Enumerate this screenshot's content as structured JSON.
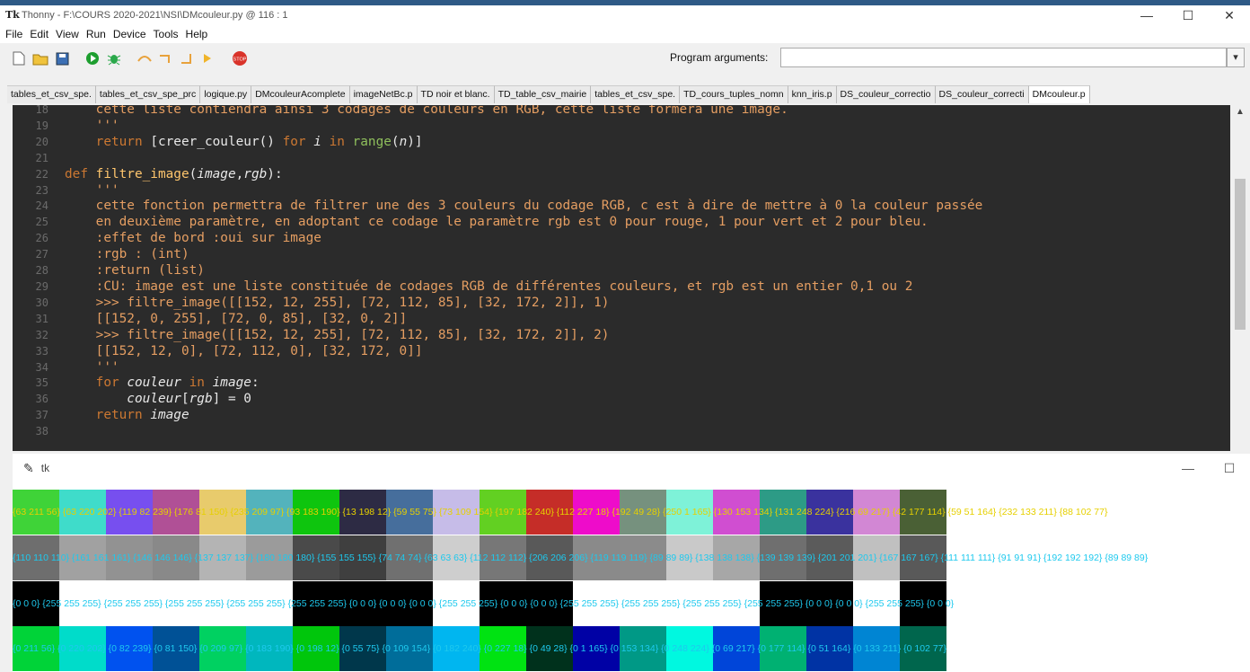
{
  "window": {
    "title": "Thonny  -  F:\\COURS 2020-2021\\NSI\\DMcouleur.py  @  116 : 1",
    "app_icon": "Tk"
  },
  "menu": [
    "File",
    "Edit",
    "View",
    "Run",
    "Device",
    "Tools",
    "Help"
  ],
  "toolbar": {
    "icons": [
      "new-file-icon",
      "open-file-icon",
      "save-icon",
      "run-icon",
      "debug-icon",
      "step-over-icon",
      "step-into-icon",
      "step-out-icon",
      "resume-icon",
      "stop-icon"
    ],
    "program_args_label": "Program arguments:",
    "program_args_value": ""
  },
  "tabs": [
    "tables_et_csv_spe.",
    "tables_et_csv_spe_prc",
    "logique.py",
    "DMcouleurAcomplete",
    "imageNetBc.p",
    "TD noir et blanc.",
    "TD_table_csv_mairie",
    "tables_et_csv_spe.",
    "TD_cours_tuples_nomn",
    "knn_iris.p",
    "DS_couleur_correctio",
    "DS_couleur_correcti",
    "DMcouleur.p"
  ],
  "editor": {
    "line_numbers": [
      "18",
      "19",
      "20",
      "21",
      "22",
      "23",
      "24",
      "25",
      "26",
      "27",
      "28",
      "29",
      "30",
      "31",
      "32",
      "33",
      "34",
      "35",
      "36",
      "37",
      "38"
    ],
    "lines": [
      [
        [
          "s",
          "    cette liste contiendra ainsi 3 codages de couleurs en RGB, cette liste formera une image."
        ]
      ],
      [
        [
          "s",
          "    '''"
        ]
      ],
      [
        [
          "kw",
          "    return "
        ],
        [
          "n",
          "[creer_couleur() "
        ],
        [
          "kw",
          "for "
        ],
        [
          "it",
          "i"
        ],
        [
          "kw",
          " in "
        ],
        [
          "bi",
          "range"
        ],
        [
          "n",
          "("
        ],
        [
          "it",
          "n"
        ],
        [
          "n",
          ")]"
        ]
      ],
      [
        [
          "n",
          ""
        ]
      ],
      [
        [
          "kw",
          "def "
        ],
        [
          "fn",
          "filtre_image"
        ],
        [
          "n",
          "("
        ],
        [
          "it",
          "image"
        ],
        [
          "n",
          ","
        ],
        [
          "it",
          "rgb"
        ],
        [
          "n",
          "):"
        ]
      ],
      [
        [
          "s",
          "    '''"
        ]
      ],
      [
        [
          "s",
          "    cette fonction permettra de filtrer une des 3 couleurs du codage RGB, c est à dire de mettre à 0 la couleur passée"
        ]
      ],
      [
        [
          "s",
          "    en deuxième paramètre, en adoptant ce codage le paramètre rgb est 0 pour rouge, 1 pour vert et 2 pour bleu."
        ]
      ],
      [
        [
          "s",
          "    :effet de bord :oui sur image"
        ]
      ],
      [
        [
          "s",
          "    :rgb : (int)"
        ]
      ],
      [
        [
          "s",
          "    :return (list)"
        ]
      ],
      [
        [
          "s",
          "    :CU: image est une liste constituée de codages RGB de différentes couleurs, et rgb est un entier 0,1 ou 2"
        ]
      ],
      [
        [
          "s",
          "    >>> filtre_image([[152, 12, 255], [72, 112, 85], [32, 172, 2]], 1)"
        ]
      ],
      [
        [
          "s",
          "    [[152, 0, 255], [72, 0, 85], [32, 0, 2]]"
        ]
      ],
      [
        [
          "s",
          "    >>> filtre_image([[152, 12, 255], [72, 112, 85], [32, 172, 2]], 2)"
        ]
      ],
      [
        [
          "s",
          "    [[152, 12, 0], [72, 112, 0], [32, 172, 0]]"
        ]
      ],
      [
        [
          "s",
          "    '''"
        ]
      ],
      [
        [
          "kw",
          "    for "
        ],
        [
          "it",
          "couleur"
        ],
        [
          "kw",
          " in "
        ],
        [
          "it",
          "image"
        ],
        [
          "n",
          ":"
        ]
      ],
      [
        [
          "it",
          "        couleur"
        ],
        [
          "n",
          "["
        ],
        [
          "it",
          "rgb"
        ],
        [
          "n",
          "] = 0"
        ]
      ],
      [
        [
          "kw",
          "    return "
        ],
        [
          "it",
          "image"
        ]
      ],
      [
        [
          "n",
          ""
        ]
      ]
    ]
  },
  "tk_window": {
    "title": "tk"
  },
  "rows": [
    {
      "colors": [
        "#3fd338",
        "#3fdcca",
        "#774fef",
        "#b05096",
        "#e8cb6c",
        "#53b3bc",
        "#0ec50e",
        "#2d2b44",
        "#466e9c",
        "#c6bce8",
        "#62d022",
        "#c52d28",
        "#ee0cca",
        "#76917e",
        "#7ef2d8",
        "#d04ed1",
        "#2d9b86",
        "#3a329e",
        "#d287d4",
        "#4a6035"
      ],
      "text": "{63 211 56} {63 220 202} {119 82 239} {176 81 150} {235 209 97} {93 183 190} {13 198 12} {59 55 75} {73 109 154} {197 182 240} {112 227 18} {192 49 28} {250 1 165} {130 153 134} {131 248 224} {216 69 217} {42 177 114} {59 51 164} {232 133 211} {88 102 77}",
      "text_color": "#e6d000"
    },
    {
      "colors": [
        "#6e6e6e",
        "#a1a1a1",
        "#929292",
        "#898989",
        "#b4b4b4",
        "#9b9b9b",
        "#4a4a4a",
        "#3f3f3f",
        "#707070",
        "#cecece",
        "#777777",
        "#595959",
        "#8a8a8a",
        "#8b8b8b",
        "#c9c9c9",
        "#a7a7a7",
        "#6f6f6f",
        "#5b5b5b",
        "#c0c0c0",
        "#595959"
      ],
      "text": "{110 110 110} {161 161 161} {146 146 146} {137 137 137} {180 180 180} {155 155 155} {74 74 74} {63 63 63} {112 112 112} {206 206 206} {119 119 119} {89 89 89} {138 138 138} {139 139 139} {201 201 201} {167 167 167} {111 111 111} {91 91 91} {192 192 192} {89 89 89}",
      "text_color": "#1ec9ee"
    },
    {
      "colors": [
        "#000000",
        "#ffffff",
        "#ffffff",
        "#ffffff",
        "#ffffff",
        "#ffffff",
        "#000000",
        "#000000",
        "#000000",
        "#ffffff",
        "#000000",
        "#000000",
        "#ffffff",
        "#ffffff",
        "#ffffff",
        "#ffffff",
        "#000000",
        "#000000",
        "#ffffff",
        "#000000"
      ],
      "text": "{0 0 0} {255 255 255} {255 255 255} {255 255 255} {255 255 255} {255 255 255} {0 0 0} {0 0 0} {0 0 0} {255 255 255} {0 0 0} {0 0 0} {255 255 255} {255 255 255} {255 255 255} {255 255 255} {0 0 0} {0 0 0} {255 255 255} {0 0 0}",
      "text_color": "#1ec9ee"
    },
    {
      "colors": [
        "#00d338",
        "#00dcca",
        "#0052ef",
        "#005196",
        "#00d161",
        "#00b7be",
        "#00c60c",
        "#00374b",
        "#006d9a",
        "#00b6f0",
        "#00e312",
        "#00311c",
        "#0001a5",
        "#009986",
        "#00f8e0",
        "#0045d9",
        "#00b172",
        "#0033a4",
        "#0085d3",
        "#00664d"
      ],
      "text": "{0 211 56} {0 220 202} {0 82 239} {0 81 150} {0 209 97} {0 183 190} {0 198 12} {0 55 75} {0 109 154} {0 182 240} {0 227 18} {0 49 28} {0 1 165} {0 153 134} {0 248 224} {0 69 217} {0 177 114} {0 51 164} {0 133 211} {0 102 77}",
      "text_color": "#1ec9ee"
    }
  ]
}
